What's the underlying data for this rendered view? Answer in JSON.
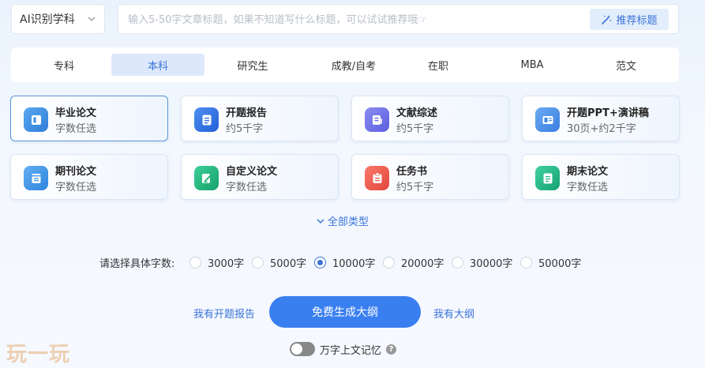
{
  "top": {
    "subject_select": "AI识别学科",
    "title_placeholder": "输入5-50字文章标题，如果不知道写什么标题，可以试试推荐哦☞",
    "recommend_label": "推荐标题"
  },
  "degree_tabs": [
    "专科",
    "本科",
    "研究生",
    "成教/自考",
    "在职",
    "MBA",
    "范文"
  ],
  "active_degree": "本科",
  "cards": [
    {
      "title": "毕业论文",
      "sub": "字数任选",
      "icon": "graduation-doc-icon",
      "color": "#3d8fe0"
    },
    {
      "title": "开题报告",
      "sub": "约5千字",
      "icon": "report-doc-icon",
      "color": "#2f6fe0"
    },
    {
      "title": "文献综述",
      "sub": "约5千字",
      "icon": "literature-doc-icon",
      "color": "#6a6de8"
    },
    {
      "title": "开题PPT+演讲稿",
      "sub": "30页+约2千字",
      "icon": "ppt-icon",
      "color": "#3f86e6"
    },
    {
      "title": "期刊论文",
      "sub": "字数任选",
      "icon": "journal-icon",
      "color": "#3f96e8"
    },
    {
      "title": "自定义论文",
      "sub": "字数任选",
      "icon": "pen-doc-icon",
      "color": "#22b37f"
    },
    {
      "title": "任务书",
      "sub": "约5千字",
      "icon": "task-book-icon",
      "color": "#ef5a4c"
    },
    {
      "title": "期末论文",
      "sub": "字数任选",
      "icon": "final-doc-icon",
      "color": "#26b587"
    }
  ],
  "all_types_label": "全部类型",
  "word_count": {
    "label": "请选择具体字数:",
    "options": [
      "3000字",
      "5000字",
      "10000字",
      "20000字",
      "30000字",
      "50000字"
    ],
    "selected": "10000字"
  },
  "actions": {
    "left_link": "我有开题报告",
    "generate": "免费生成大纲",
    "right_link": "我有大纲"
  },
  "memory": {
    "label": "万字上文记忆",
    "help": "?"
  },
  "watermark": "玩一玩"
}
